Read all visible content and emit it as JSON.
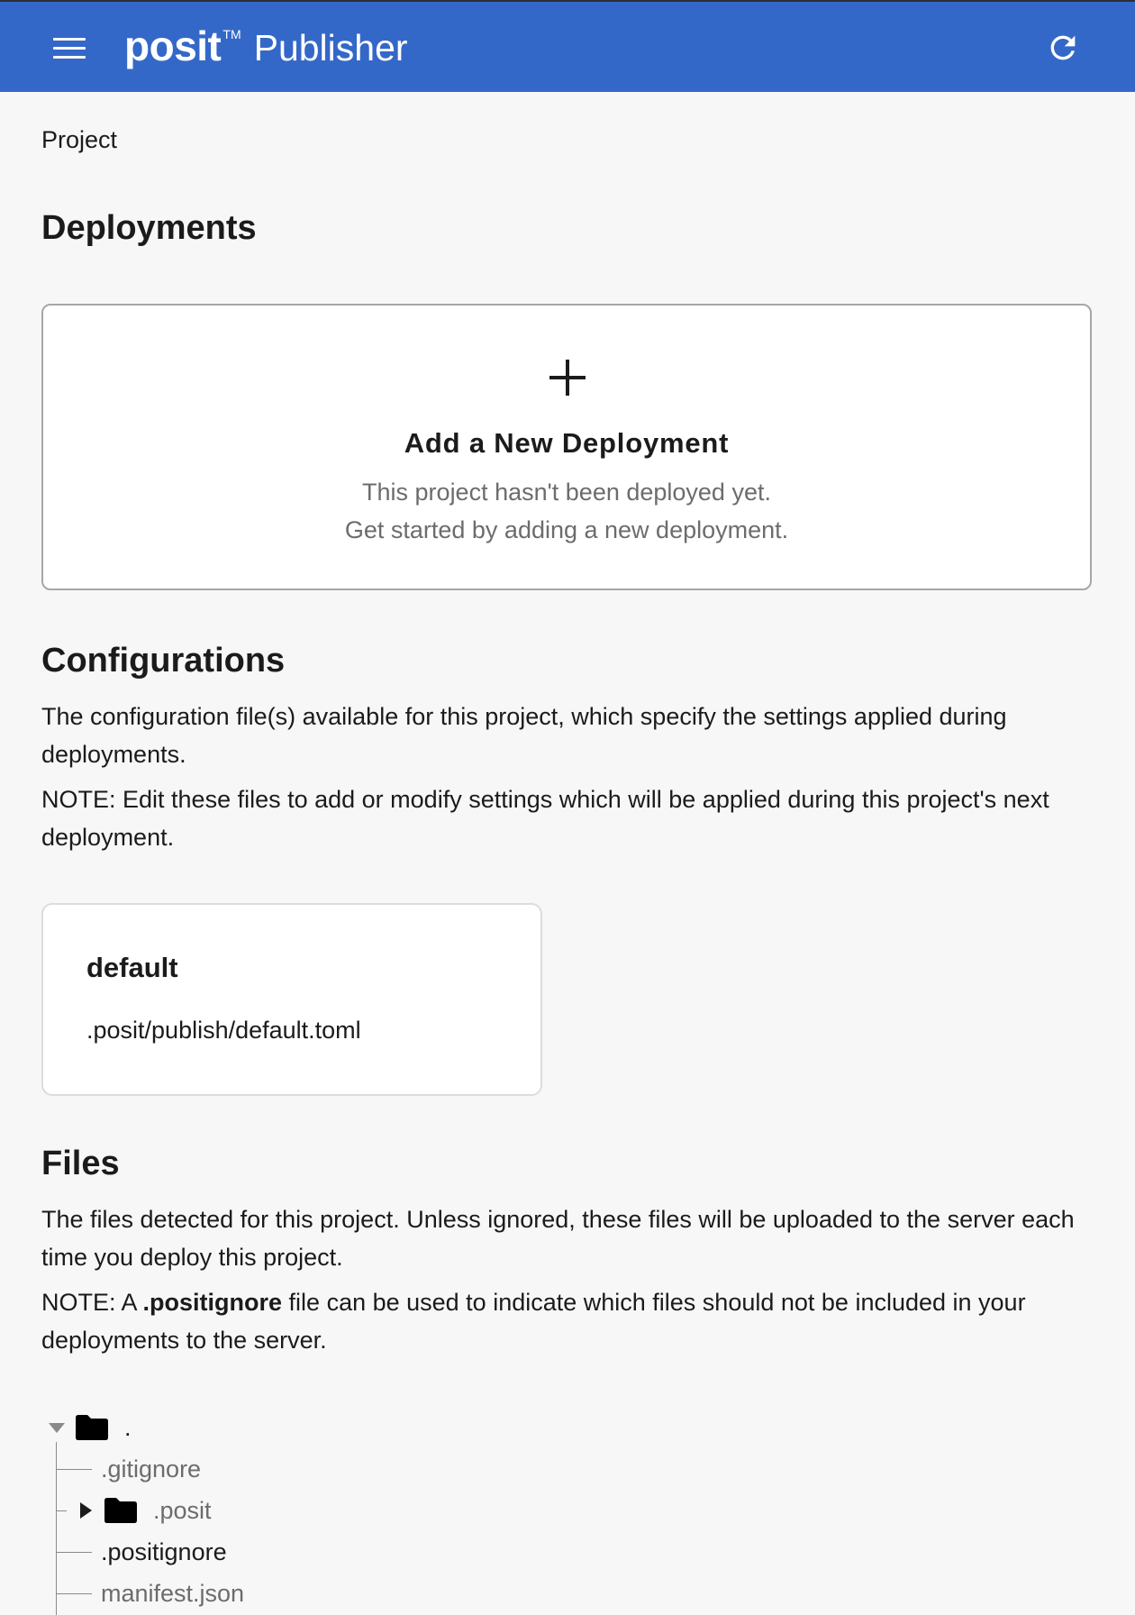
{
  "header": {
    "menu_icon": "hamburger-menu-icon",
    "brand_logo": "posit",
    "brand_tm": "TM",
    "app_name": "Publisher",
    "refresh_icon": "refresh-icon",
    "bg_color": "#3468c8"
  },
  "project": {
    "label": "Project"
  },
  "deployments": {
    "heading": "Deployments",
    "add_card": {
      "icon": "plus-icon",
      "title": "Add a New Deployment",
      "line1": "This project hasn't been deployed yet.",
      "line2": "Get started by adding a new deployment."
    }
  },
  "configurations": {
    "heading": "Configurations",
    "description": "The configuration file(s) available for this project, which specify the settings applied during deployments.",
    "note": "NOTE: Edit these files to add or modify settings which will be applied during this project's next deployment.",
    "items": [
      {
        "name": "default",
        "path": ".posit/publish/default.toml"
      }
    ]
  },
  "files": {
    "heading": "Files",
    "description": "The files detected for this project. Unless ignored, these files will be uploaded to the server each time you deploy this project.",
    "note_prefix": "NOTE: A ",
    "note_bold": ".positignore",
    "note_suffix": " file can be used to indicate which files should not be included in your deployments to the server.",
    "tree": {
      "root": ".",
      "children": [
        {
          "name": ".gitignore",
          "type": "file"
        },
        {
          "name": ".posit",
          "type": "folder",
          "expanded": false
        },
        {
          "name": ".positignore",
          "type": "file"
        },
        {
          "name": "manifest.json",
          "type": "file"
        }
      ]
    }
  }
}
